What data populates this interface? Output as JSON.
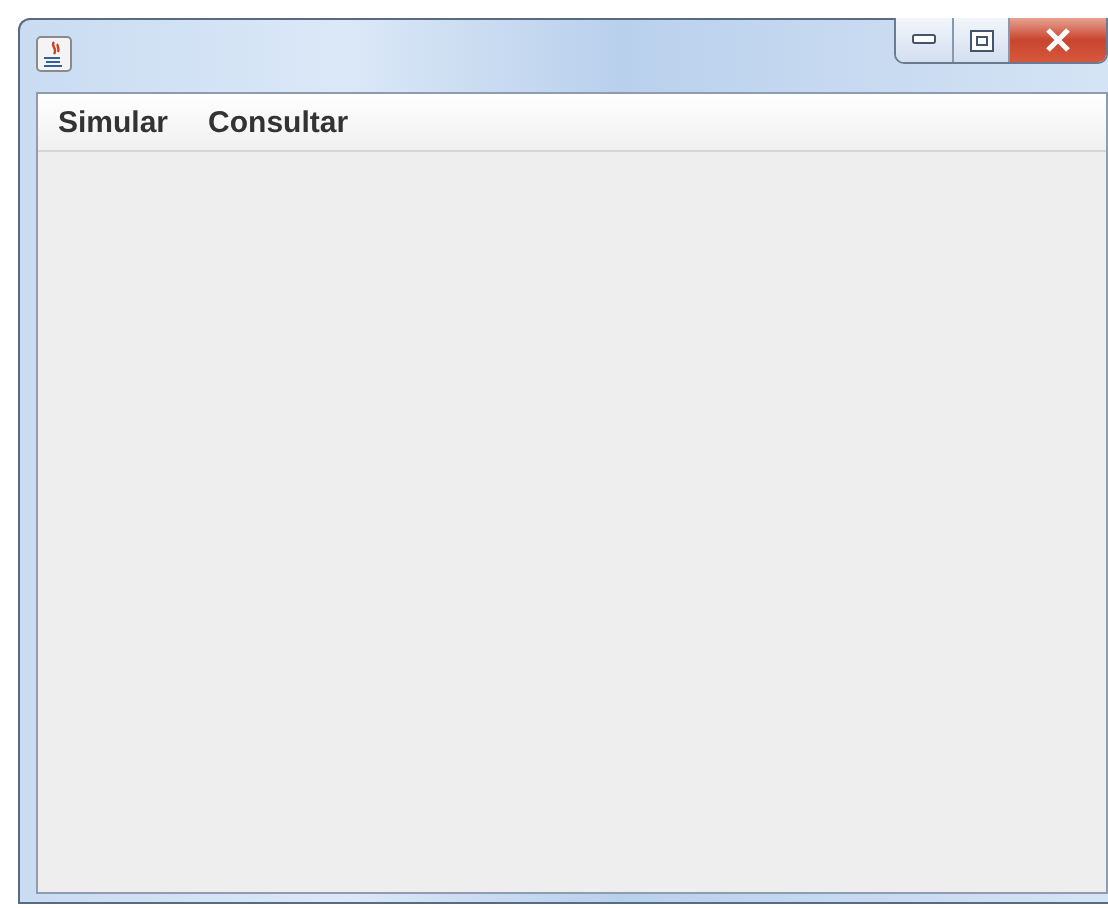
{
  "menu_bar": {
    "items": [
      {
        "label": "Simular"
      },
      {
        "label": "Consultar"
      }
    ]
  }
}
